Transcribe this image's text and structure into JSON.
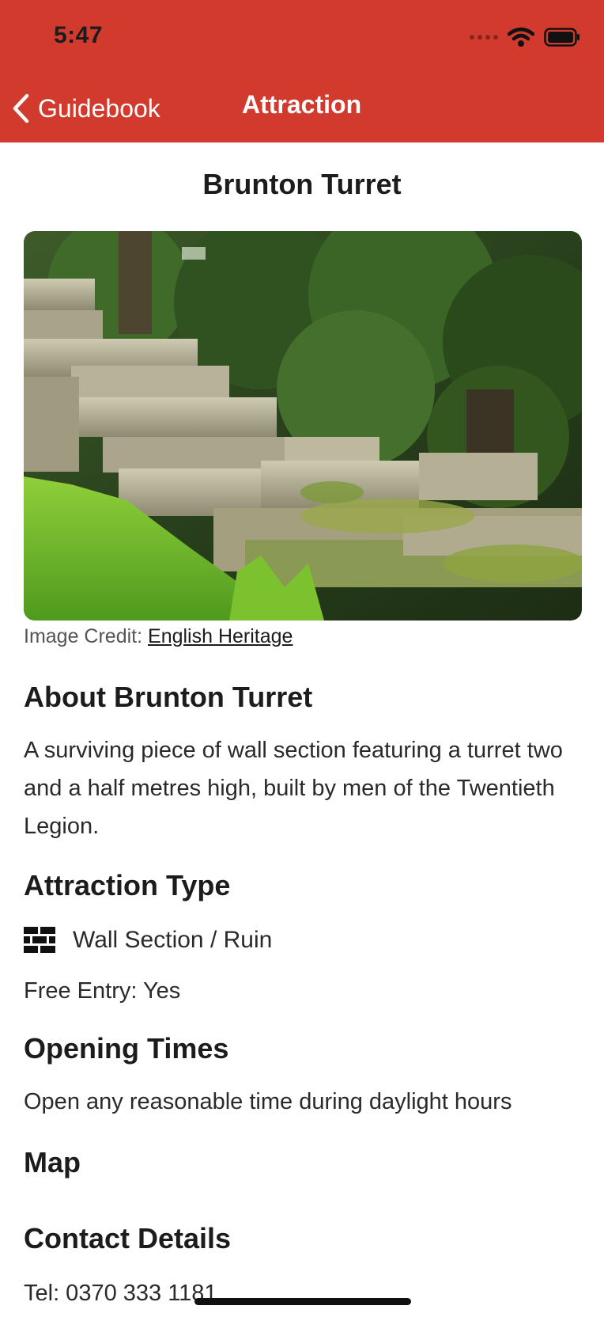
{
  "colors": {
    "brand": "#d13a2c"
  },
  "status_bar": {
    "time": "5:47",
    "icons": [
      "signal-icon",
      "wifi-icon",
      "battery-icon"
    ]
  },
  "nav": {
    "back_label": "Guidebook",
    "title": "Attraction"
  },
  "page": {
    "title": "Brunton Turret"
  },
  "image": {
    "credit_prefix": "Image Credit:",
    "credit_link": "English Heritage"
  },
  "about": {
    "heading": "About Brunton Turret",
    "text": "A surviving piece of wall section featuring a turret two and a half metres high, built by men of the Twentieth Legion."
  },
  "attraction_type": {
    "heading": "Attraction Type",
    "type_icon": "brick-wall-icon",
    "type_label": "Wall Section / Ruin",
    "free_entry": "Free Entry: Yes"
  },
  "opening_times": {
    "heading": "Opening Times",
    "text": "Open any reasonable time during daylight hours"
  },
  "map": {
    "heading": "Map"
  },
  "contact": {
    "heading": "Contact Details",
    "tel": "Tel: 0370 333 1181"
  }
}
